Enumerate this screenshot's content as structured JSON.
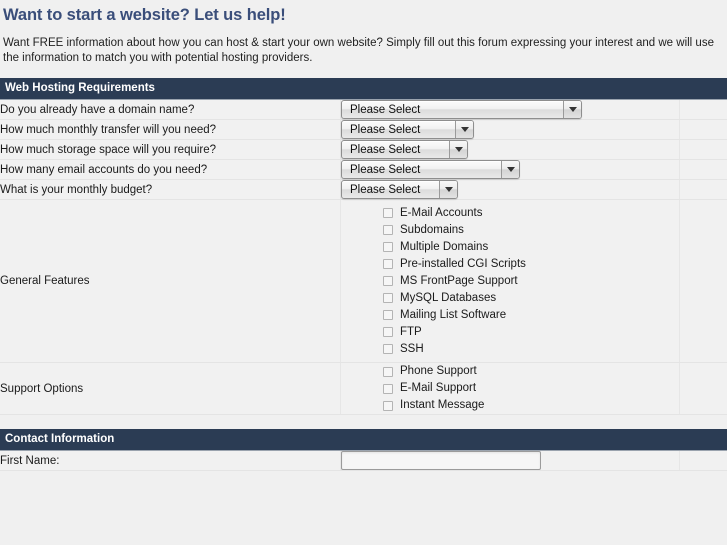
{
  "page": {
    "title": "Want to start a website? Let us help!",
    "intro": "Want FREE information about how you can host & start your own website? Simply fill out this forum expressing your interest and we will use the information to match you with potential hosting providers.",
    "title_color": "#3a4e7a",
    "bar_color": "#2b3c54",
    "background": "#f0f0f0"
  },
  "sections": {
    "hosting": {
      "header": "Web Hosting Requirements"
    },
    "contact": {
      "header": "Contact Information"
    }
  },
  "selects": {
    "placeholder": "Please Select",
    "rows": [
      {
        "label": "Do you already have a domain name?",
        "value": "Please Select"
      },
      {
        "label": "How much monthly transfer will you need?",
        "value": "Please Select"
      },
      {
        "label": "How much storage space will you require?",
        "value": "Please Select"
      },
      {
        "label": "How many email accounts do you need?",
        "value": "Please Select"
      },
      {
        "label": "What is your monthly budget?",
        "value": "Please Select"
      }
    ]
  },
  "general_features": {
    "label": "General Features",
    "options": [
      {
        "label": "E-Mail Accounts",
        "checked": false
      },
      {
        "label": "Subdomains",
        "checked": false
      },
      {
        "label": "Multiple Domains",
        "checked": false
      },
      {
        "label": "Pre-installed CGI Scripts",
        "checked": false
      },
      {
        "label": "MS FrontPage Support",
        "checked": false
      },
      {
        "label": "MySQL Databases",
        "checked": false
      },
      {
        "label": "Mailing List Software",
        "checked": false
      },
      {
        "label": "FTP",
        "checked": false
      },
      {
        "label": "SSH",
        "checked": false
      }
    ]
  },
  "support_options": {
    "label": "Support Options",
    "options": [
      {
        "label": "Phone Support",
        "checked": false
      },
      {
        "label": "E-Mail Support",
        "checked": false
      },
      {
        "label": "Instant Message",
        "checked": false
      }
    ]
  },
  "contact_fields": [
    {
      "label": "First Name:",
      "value": "",
      "placeholder": ""
    }
  ],
  "icons": {
    "dropdown_arrow": "chevron-down-icon"
  }
}
